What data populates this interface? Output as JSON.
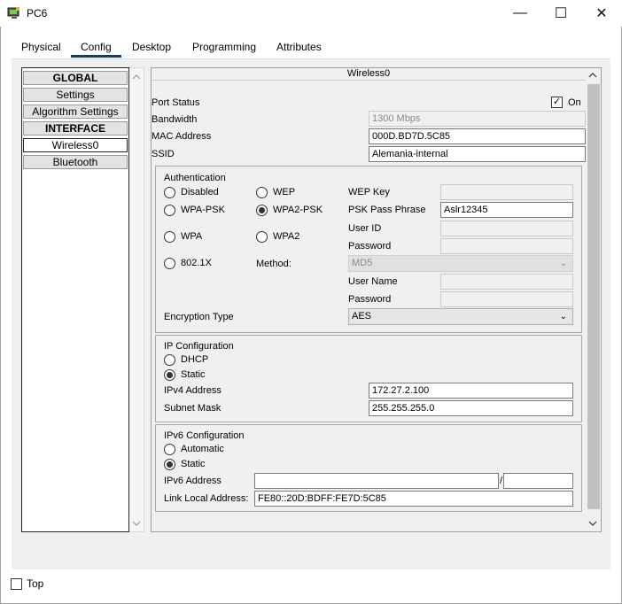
{
  "window": {
    "title": "PC6",
    "minimize_glyph": "—",
    "maximize_glyph": "☐",
    "close_glyph": "✕"
  },
  "tabs": [
    {
      "label": "Physical"
    },
    {
      "label": "Config",
      "selected": true
    },
    {
      "label": "Desktop"
    },
    {
      "label": "Programming"
    },
    {
      "label": "Attributes"
    }
  ],
  "sidebar": {
    "items": [
      {
        "label": "GLOBAL"
      },
      {
        "label": "Settings"
      },
      {
        "label": "Algorithm Settings"
      },
      {
        "label": "INTERFACE"
      },
      {
        "label": "Wireless0",
        "selected": true
      },
      {
        "label": "Bluetooth"
      }
    ]
  },
  "panel": {
    "title": "Wireless0",
    "port_status_label": "Port Status",
    "port_status_on_label": "On",
    "port_status_on": true,
    "bandwidth_label": "Bandwidth",
    "bandwidth_value": "1300 Mbps",
    "mac_label": "MAC Address",
    "mac_value": "000D.BD7D.5C85",
    "ssid_label": "SSID",
    "ssid_value": "Alemania-internal"
  },
  "auth": {
    "title": "Authentication",
    "options": {
      "disabled": "Disabled",
      "wep": "WEP",
      "wpa_psk": "WPA-PSK",
      "wpa2_psk": "WPA2-PSK",
      "wpa": "WPA",
      "wpa2": "WPA2",
      "dot1x": "802.1X"
    },
    "selected": "WPA2-PSK",
    "wep_key_label": "WEP Key",
    "psk_label": "PSK Pass Phrase",
    "psk_value": "Aslr12345",
    "user_id_label": "User ID",
    "password_label": "Password",
    "method_label": "Method:",
    "method_value": "MD5",
    "user_name_label": "User Name",
    "password2_label": "Password",
    "encryption_label": "Encryption Type",
    "encryption_value": "AES"
  },
  "ip": {
    "title": "IP Configuration",
    "dhcp_label": "DHCP",
    "static_label": "Static",
    "mode": "Static",
    "ipv4_label": "IPv4 Address",
    "ipv4_value": "172.27.2.100",
    "mask_label": "Subnet Mask",
    "mask_value": "255.255.255.0"
  },
  "ipv6": {
    "title": "IPv6 Configuration",
    "auto_label": "Automatic",
    "static_label": "Static",
    "mode": "Static",
    "address_label": "IPv6 Address",
    "address_value": "",
    "separator": "/",
    "prefix_value": "",
    "link_local_label": "Link Local Address:",
    "link_local_value": "FE80::20D:BDFF:FE7D:5C85"
  },
  "bottom": {
    "top_label": "Top",
    "top_checked": false
  },
  "icons": {
    "app": "pc-app-icon",
    "scroll_up": "chevron-up-icon",
    "scroll_down": "chevron-down-icon",
    "dropdown": "chevron-down-icon"
  }
}
